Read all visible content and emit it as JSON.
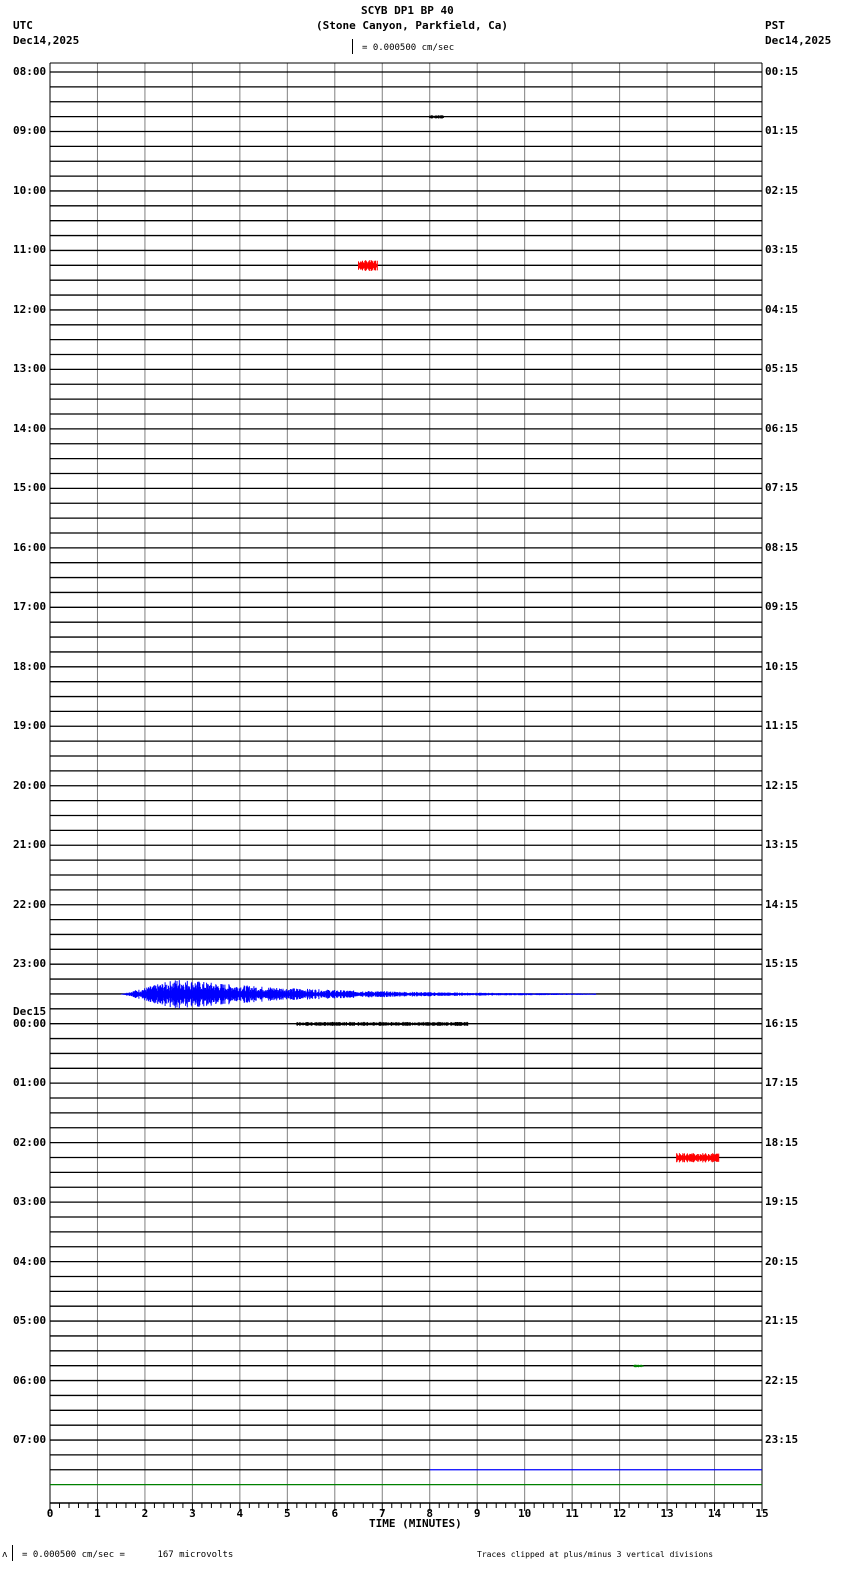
{
  "header": {
    "title": "SCYB DP1 BP 40",
    "subtitle": "(Stone Canyon, Parkfield, Ca)",
    "left_tz": "UTC",
    "left_date": "Dec14,2025",
    "right_tz": "PST",
    "right_date": "Dec14,2025",
    "scale_text": "= 0.000500 cm/sec"
  },
  "footer": {
    "scale_text": "= 0.000500 cm/sec =      167 microvolts",
    "clip_note": "Traces clipped at plus/minus 3 vertical divisions"
  },
  "chart_data": {
    "type": "line",
    "title": "SCYB DP1 BP 40",
    "xlabel": "TIME (MINUTES)",
    "xlim": [
      0,
      15
    ],
    "x_ticks": [
      "0",
      "1",
      "2",
      "3",
      "4",
      "5",
      "6",
      "7",
      "8",
      "9",
      "10",
      "11",
      "12",
      "13",
      "14",
      "15"
    ],
    "traces_per_hour": 4,
    "trace_count": 96,
    "date_change_label": "Dec15",
    "utc_labels": [
      "08:00",
      "09:00",
      "10:00",
      "11:00",
      "12:00",
      "13:00",
      "14:00",
      "15:00",
      "16:00",
      "17:00",
      "18:00",
      "19:00",
      "20:00",
      "21:00",
      "22:00",
      "23:00",
      "00:00",
      "01:00",
      "02:00",
      "03:00",
      "04:00",
      "05:00",
      "06:00",
      "07:00"
    ],
    "pst_labels": [
      "00:15",
      "01:15",
      "02:15",
      "03:15",
      "04:15",
      "05:15",
      "06:15",
      "07:15",
      "08:15",
      "09:15",
      "10:15",
      "11:15",
      "12:15",
      "13:15",
      "14:15",
      "15:15",
      "16:15",
      "17:15",
      "18:15",
      "19:15",
      "20:15",
      "21:15",
      "22:15",
      "23:15"
    ],
    "colors": {
      "black": "#000000",
      "red": "#ff0000",
      "blue": "#0000ff",
      "green": "#008000",
      "grid": "#808080"
    },
    "events": [
      {
        "trace": 3,
        "start": 8.0,
        "end": 8.3,
        "amp": 0.1,
        "color": "#000000"
      },
      {
        "trace": 13,
        "start": 6.5,
        "end": 6.9,
        "amp": 0.35,
        "color": "#ff0000"
      },
      {
        "trace": 62,
        "start": 1.5,
        "end": 11.5,
        "amp": 0.85,
        "color": "#0000ff"
      },
      {
        "trace": 64,
        "start": 5.2,
        "end": 8.8,
        "amp": 0.12,
        "color": "#000000"
      },
      {
        "trace": 73,
        "start": 13.2,
        "end": 14.1,
        "amp": 0.3,
        "color": "#ff0000"
      },
      {
        "trace": 87,
        "start": 12.3,
        "end": 12.5,
        "amp": 0.08,
        "color": "#008000"
      }
    ],
    "partial_traces": [
      {
        "trace": 94,
        "black_until": 8,
        "color": "#0000ff"
      },
      {
        "trace": 95,
        "color": "#008000"
      }
    ]
  }
}
